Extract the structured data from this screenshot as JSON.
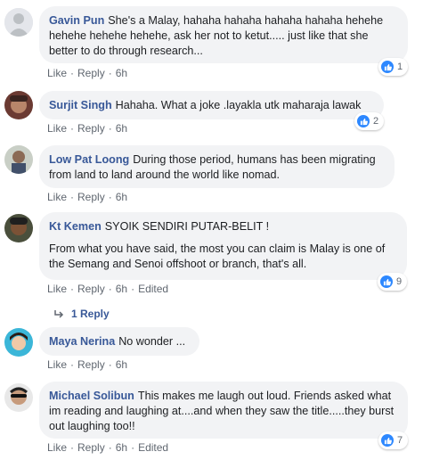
{
  "comments": [
    {
      "name": "Gavin Pun",
      "text": "She's a Malay, hahaha hahaha hahaha hahaha hehehe hehehe hehehe hehehe, ask her not to ketut..... just like that she better to do through research...",
      "actions": {
        "like": "Like",
        "reply": "Reply",
        "time": "6h"
      },
      "reactions": "1",
      "avatar": "default-avatar-icon"
    },
    {
      "name": "Surjit Singh",
      "text": "Hahaha. What a joke .layakla utk maharaja lawak",
      "actions": {
        "like": "Like",
        "reply": "Reply",
        "time": "6h"
      },
      "reactions": "2",
      "avatar": "user-photo"
    },
    {
      "name": "Low Pat Loong",
      "text": "During those period, humans has been migrating from land to land around the world like nomad.",
      "actions": {
        "like": "Like",
        "reply": "Reply",
        "time": "6h"
      },
      "avatar": "user-photo"
    },
    {
      "name": "Kt Kemen",
      "text": "SYOIK SENDIRI PUTAR-BELIT !",
      "text2": "From what you have said, the most you can claim is Malay is one of the Semang and Senoi offshoot or branch, that's all.",
      "actions": {
        "like": "Like",
        "reply": "Reply",
        "time": "6h",
        "edited": "Edited"
      },
      "reactions": "9",
      "replies_link": "1 Reply",
      "avatar": "user-photo"
    },
    {
      "name": "Maya Nerina",
      "text": "No wonder ...",
      "actions": {
        "like": "Like",
        "reply": "Reply",
        "time": "6h"
      },
      "avatar": "user-photo"
    },
    {
      "name": "Michael Solibun",
      "text": "This makes me laugh out loud. Friends asked what im reading and laughing at....and when they saw the title.....they burst out laughing too!!",
      "actions": {
        "like": "Like",
        "reply": "Reply",
        "time": "6h",
        "edited": "Edited"
      },
      "reactions": "7",
      "avatar": "user-photo"
    }
  ],
  "colors": {
    "name": "#385898",
    "bubble": "#f2f3f5",
    "meta": "#606770",
    "like": "#2d88ff"
  }
}
